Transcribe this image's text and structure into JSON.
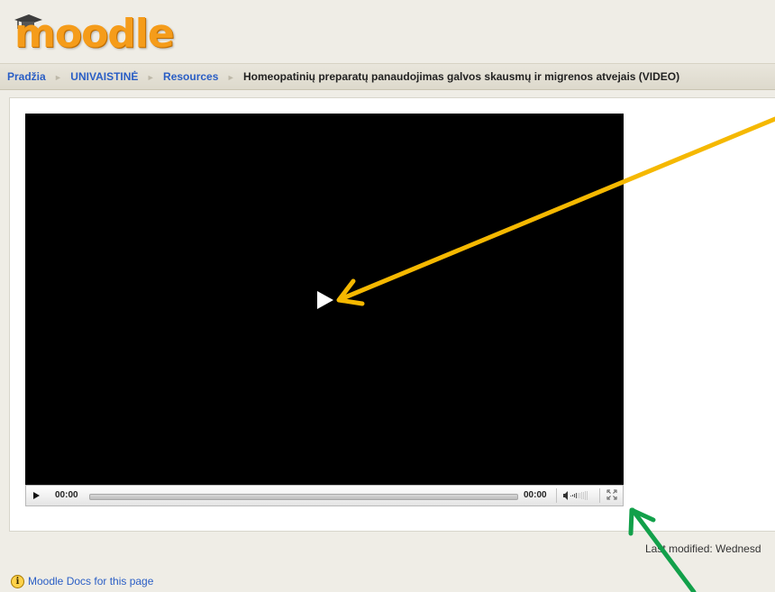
{
  "header": {
    "logo_text": "moodle"
  },
  "breadcrumb": {
    "items": [
      {
        "label": "Pradžia"
      },
      {
        "label": "UNIVAISTINĖ"
      },
      {
        "label": "Resources"
      },
      {
        "label": "Homeopatinių preparatų panaudojimas galvos skausmų ir migrenos atvejais (VIDEO)"
      }
    ],
    "separator": "►"
  },
  "player": {
    "big_play_icon": "play-icon",
    "time_current": "00:00",
    "time_total": "00:00",
    "progress": 0,
    "icons": [
      "play-icon",
      "volume-icon",
      "fullscreen-icon"
    ]
  },
  "footer": {
    "last_modified": "Last modified: Wednesd",
    "docs_link": "Moodle Docs for this page",
    "docs_icon": "info-icon"
  },
  "annotations": {
    "arrow_colors": [
      "#f5b800",
      "#12a04a"
    ]
  }
}
